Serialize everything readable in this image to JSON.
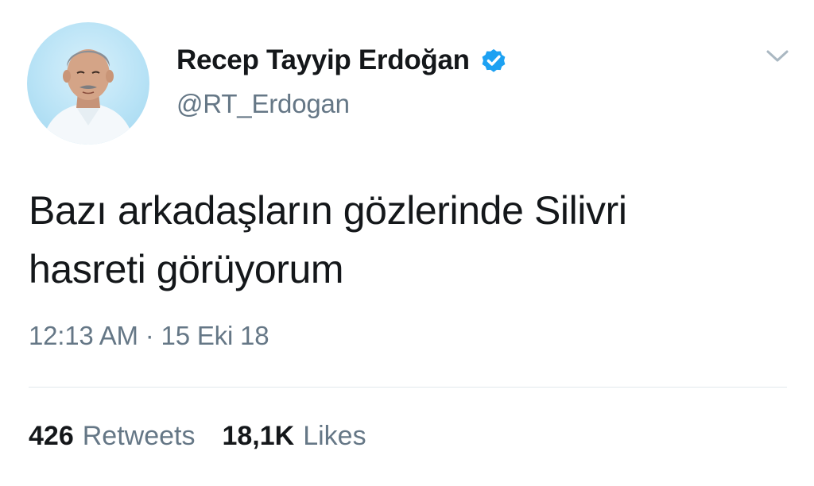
{
  "author": {
    "display_name": "Recep Tayyip Erdoğan",
    "handle": "@RT_Erdogan",
    "verified": true,
    "avatar_icon": "profile-photo",
    "verified_icon": "verified-badge-icon",
    "verified_color": "#1da1f2"
  },
  "tweet": {
    "text_line_1": "Bazı arkadaşların gözlerinde Silivri",
    "text_line_2": "hasreti görüyorum",
    "timestamp": "12:13 AM · 15 Eki 18"
  },
  "stats": {
    "retweets_count": "426",
    "retweets_label": "Retweets",
    "likes_count": "18,1K",
    "likes_label": "Likes"
  },
  "menu": {
    "icon": "chevron-down-icon"
  },
  "colors": {
    "text_primary": "#14171a",
    "text_secondary": "#657786",
    "divider": "#e1e8ed",
    "background": "#ffffff"
  }
}
